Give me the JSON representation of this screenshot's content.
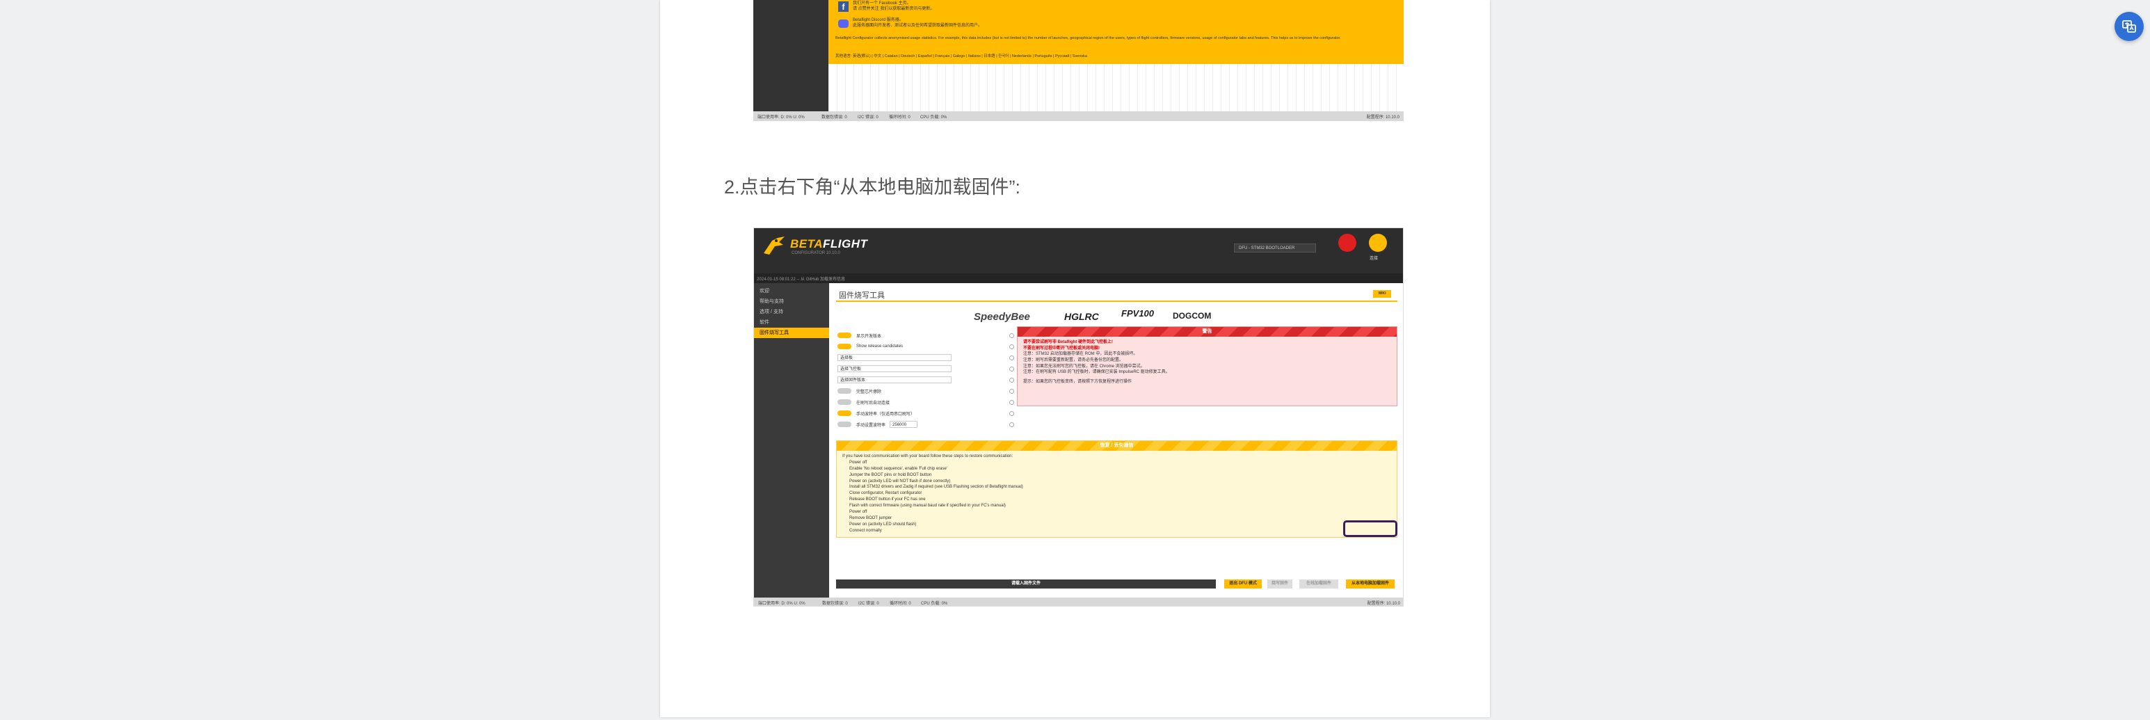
{
  "heading": "2.点击右下角“从本地电脑加载固件”:",
  "float_button": {
    "icon": "translate-icon"
  },
  "shot1": {
    "facebook_title": "我们只有一个 Facebook 主页。",
    "facebook_sub": "请 点赞并关注 我们以获取最新资讯与更新。",
    "discord_title": "Betaflight Discord 服务器。",
    "discord_sub": "此服务器面向开发者、测试者以及任何希望获取最新固件信息的用户。",
    "english_notice": "Betaflight Configurator collects anonymised usage statistics. For example, this data includes (but is not limited to) the number of launches, geographical region of the users, types of flight controllers, firmware versions, usage of configurator tabs and features. This helps us to improve the configurator.",
    "languages": "其他语言: 英语(默认) | 中文 | Catalan | Deutsch | Español | Français | Galego | Italiano | 日本語 | 한국어 | Nederlands | Português | Pусский | Svenska",
    "status_items": [
      "端口使用率: D: 0% U: 0%",
      "数据包错误: 0",
      "I2C 错误: 0",
      "循环时间: 0",
      "CPU 负载: 0%"
    ],
    "status_right": "配置程序: 10.10.0"
  },
  "bf": {
    "brand_prefix": "BETA",
    "brand_suffix": "FLIGHT",
    "version": "CONFIGURATOR 10.10.0",
    "port_select": "DFU - STM32 BOOTLOADER",
    "connect_label": "连接",
    "log_text": "2024-01-15 08:01:22 -- 从 GitHub 加载发布信息",
    "nav": [
      "欢迎",
      "帮助与支持",
      "选项 / 支持",
      "软件",
      "固件烧写工具"
    ],
    "title": "固件烧写工具",
    "wiki": "WIKI",
    "sponsors": [
      "SpeedyBee",
      "HGLRC",
      "FPV100",
      "DOGCOM"
    ],
    "options": [
      {
        "type": "toggle",
        "on": true,
        "label": "显示开发版本"
      },
      {
        "type": "toggle",
        "on": true,
        "label": "Show release candidates"
      },
      {
        "type": "select",
        "value": "选择板"
      },
      {
        "type": "select",
        "value": "选择飞控板"
      },
      {
        "type": "select",
        "value": "选择固件版本"
      },
      {
        "type": "toggle",
        "on": false,
        "label": "完整芯片擦除"
      },
      {
        "type": "toggle",
        "on": false,
        "label": "在刷写后自动连接"
      },
      {
        "type": "toggle",
        "on": true,
        "label": "手动波特率（仅适用串口刷写）"
      },
      {
        "type": "toggle",
        "on": false,
        "label": "手动设置波特率",
        "select": "256000"
      }
    ],
    "warning_title": "警告",
    "warning_lines": [
      "请不要尝试刷写非 Betaflight 硬件到此飞控板上!",
      "不要在刷写过程中断开飞控板或关闭电脑!",
      "注意：STM32 启动加载器存储在 ROM 中，因此不会被损坏。",
      "注意：刷写后需要重新配置，请务必先备份您的配置。",
      "注意：如果您无法刷写您的飞控板，请在 Chrome 浏览器中尝试。",
      "注意：在刷写配有 USB 的飞控板时，请确保已安装 ImpulseRC 驱动修复工具。"
    ],
    "recovery_line": "提示：如果您的飞控板变砖，请按照下方恢复程序进行操作",
    "recovery_title": "恢复 / 丢失通信",
    "recovery_lines": [
      "If you have lost communication with your board follow these steps to restore communication:",
      "Power off",
      "Enable 'No reboot sequence', enable 'Full chip erase'",
      "Jumper the BOOT pins or hold BOOT button",
      "Power on (activity LED will NOT flash if done correctly)",
      "Install all STM32 drivers and Zadig if required (see USB Flashing section of Betaflight manual)",
      "Close configurator, Restart configurator",
      "Release BOOT button if your FC has one",
      "Flash with correct firmware (using manual baud rate if specified in your FC's manual)",
      "Power off",
      "Remove BOOT jumper",
      "Power on (activity LED should flash)",
      "Connect normally"
    ],
    "progress_label": "请载入固件文件",
    "btn_dfu": "退出 DFU 模式",
    "btn_flash": "烧写固件",
    "btn_online": "在线加载固件",
    "btn_local": "从本地电脑加载固件",
    "status_items": [
      "端口使用率: D: 0% U: 0%",
      "数据包错误: 0",
      "I2C 错误: 0",
      "循环时间: 0",
      "CPU 负载: 0%"
    ],
    "status_right": "配置程序: 10.10.0"
  }
}
